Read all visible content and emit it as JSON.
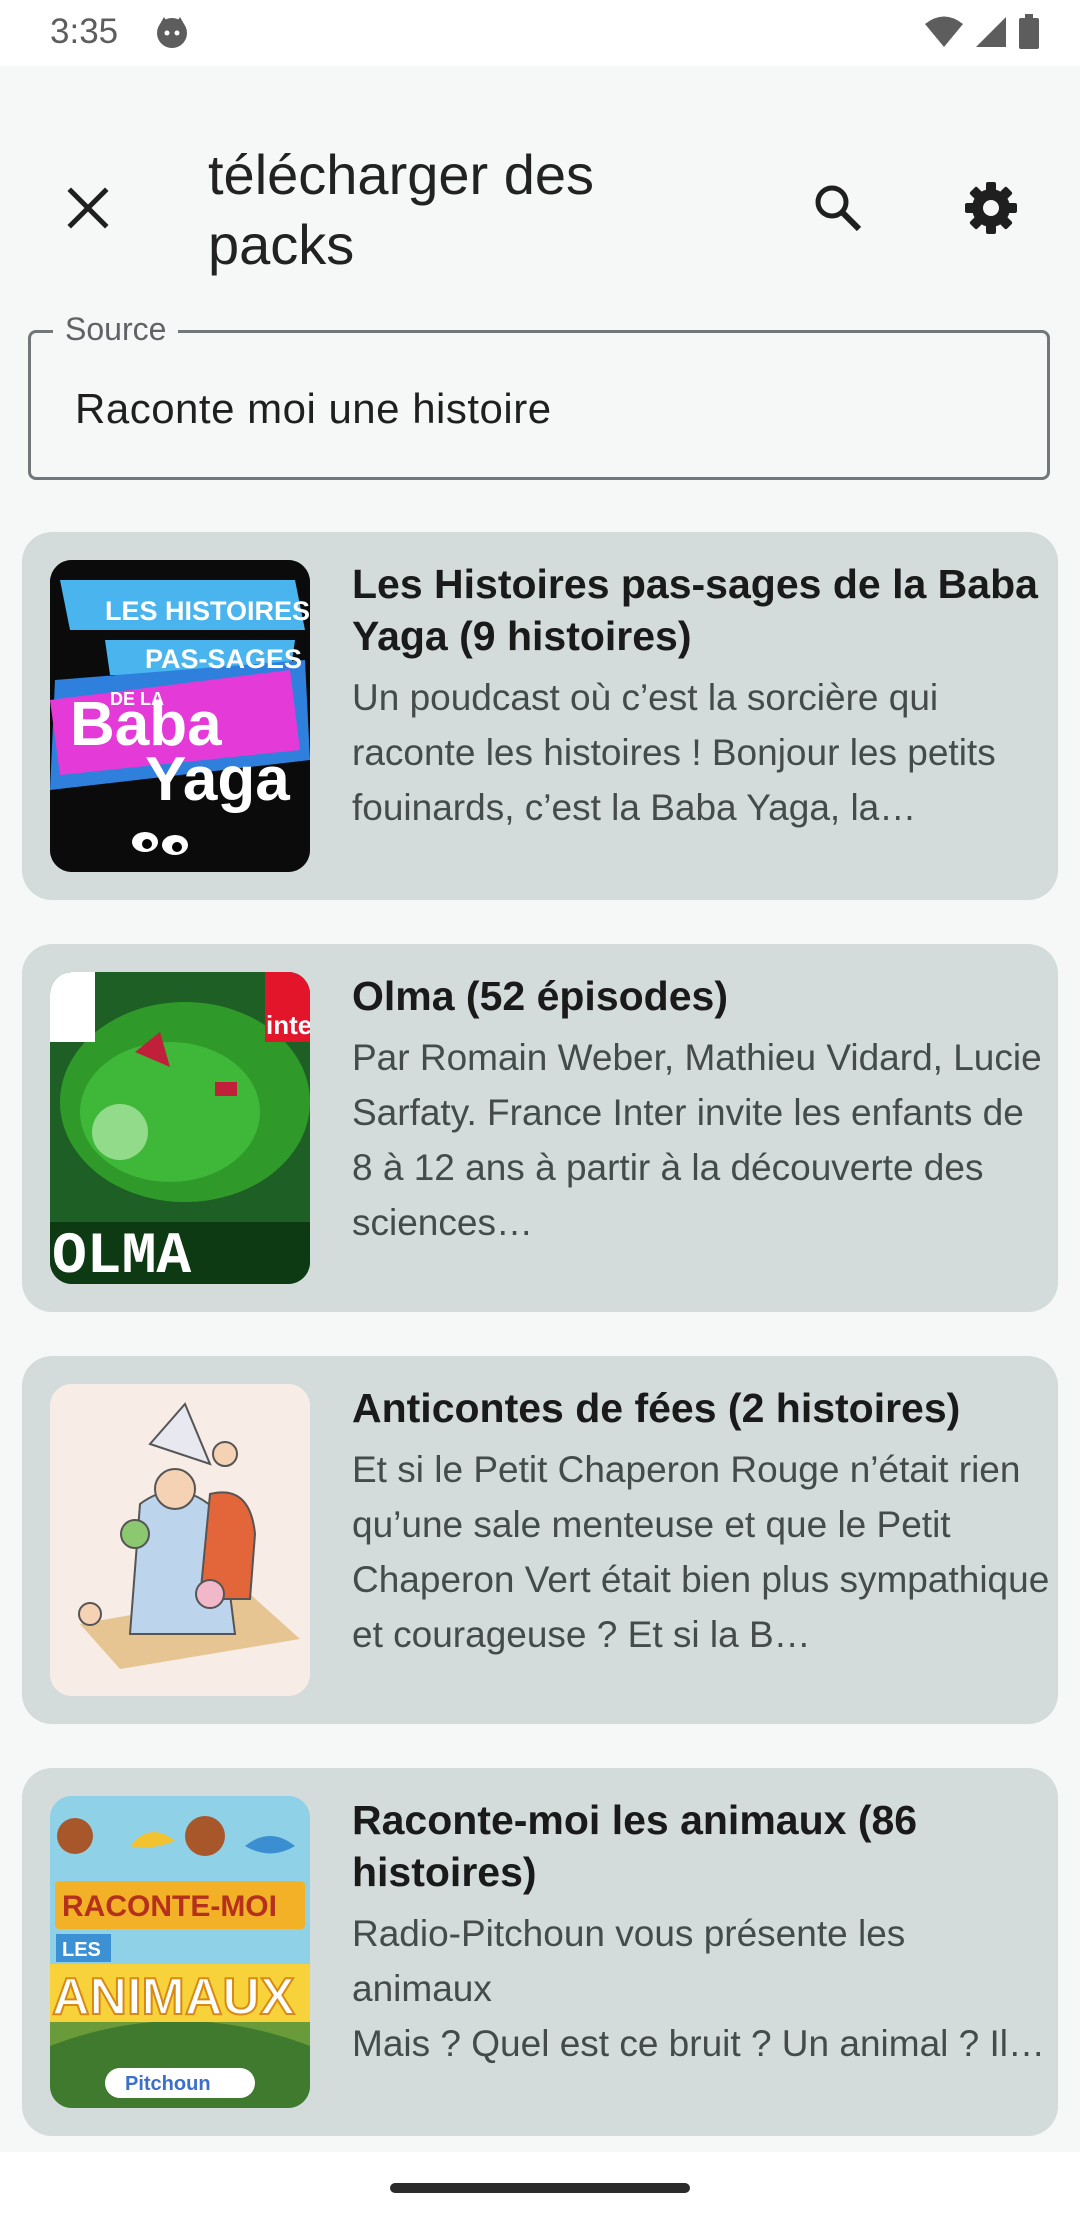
{
  "status": {
    "time": "3:35"
  },
  "appbar": {
    "title": "télécharger des packs",
    "icons": [
      "close-icon",
      "search-icon",
      "gear-icon"
    ]
  },
  "source": {
    "label": "Source",
    "value": "Raconte moi une histoire"
  },
  "cards": [
    {
      "title": "Les Histoires pas-sages de la Baba Yaga (9 histoires)",
      "description": "Un poudcast où c’est la sorcière qui raconte les histoires ! Bonjour les petits fouinards, c’est la Baba Yaga, la sorcière…",
      "thumb_text": [
        "LES HISTOIRES",
        "PAS-SAGES",
        "DE LA",
        "Baba",
        "Yaga"
      ]
    },
    {
      "title": "Olma (52 épisodes)",
      "description": "Par Romain Weber, Mathieu Vidard, Lucie Sarfaty. France Inter invite les enfants de 8 à 12 ans à partir à la découverte des sciences…",
      "thumb_text": [
        "OLMA",
        "inte"
      ]
    },
    {
      "title": "Anticontes de fées (2 histoires)",
      "description": "Et si le Petit Chaperon Rouge n’était rien qu’une sale menteuse et que le Petit Chaperon Vert était bien plus sympathique et courageuse ? Et si la B…",
      "thumb_text": []
    },
    {
      "title": "Raconte-moi les animaux (86 histoires)",
      "description": "Radio-Pitchoun vous présente les animaux\nMais ? Quel est ce bruit ? Un animal ? Il …",
      "thumb_text": [
        "RACONTE-MOI",
        "LES",
        "ANIMAUX",
        "Pitchoun"
      ]
    }
  ],
  "colors": {
    "card_bg": "#d3dcdb",
    "page_bg": "#f6f8f7",
    "field_border": "#72777a"
  }
}
